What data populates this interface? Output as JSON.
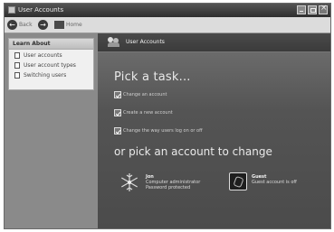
{
  "window": {
    "title": "User Accounts",
    "minimize_icon": "minimize-icon",
    "maximize_icon": "maximize-icon",
    "close_icon": "close-icon"
  },
  "toolbar": {
    "back_label": "Back",
    "home_label": "Home"
  },
  "sidebar": {
    "panel_title": "Learn About",
    "items": [
      {
        "label": "User accounts",
        "icon": "document-icon"
      },
      {
        "label": "User account types",
        "icon": "document-icon"
      },
      {
        "label": "Switching users",
        "icon": "document-icon"
      }
    ]
  },
  "main": {
    "header_title": "User Accounts",
    "pick_task": "Pick a task...",
    "tasks": [
      {
        "label": "Change an account"
      },
      {
        "label": "Create a new account"
      },
      {
        "label": "Change the way users log on or off"
      }
    ],
    "pick_account": "or pick an account to change",
    "accounts": [
      {
        "name": "Jon",
        "line1": "Computer administrator",
        "line2": "Password protected",
        "icon": "snowflake-icon"
      },
      {
        "name": "Guest",
        "line1": "Guest account is off",
        "line2": "",
        "icon": "guest-icon"
      }
    ]
  }
}
